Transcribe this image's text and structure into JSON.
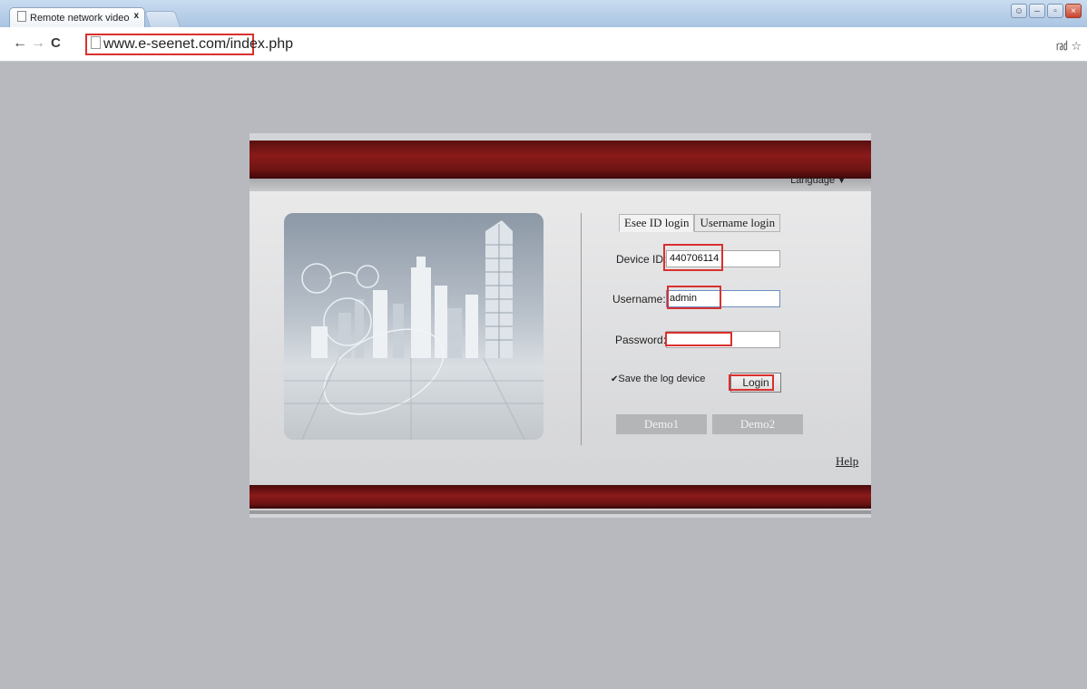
{
  "browser": {
    "tab_title": "Remote network video",
    "tab_close": "x",
    "url": "www.e-seenet.com/index.php"
  },
  "page": {
    "language_label": "Language",
    "tabs": [
      "Esee ID login",
      "Username login"
    ],
    "device_id_label": "Device ID:",
    "device_id_value": "440706114",
    "username_label": "Username:",
    "username_value": "admin",
    "password_label": "Password:",
    "password_value": "",
    "save_log_label": "Save the log device",
    "login_label": "Login",
    "demo1_label": "Demo1",
    "demo2_label": "Demo2",
    "help_label": "Help"
  },
  "colors": {
    "band_red": "#8b1a1a",
    "highlight_red": "#d9302f",
    "page_bg": "#b8b9be"
  }
}
